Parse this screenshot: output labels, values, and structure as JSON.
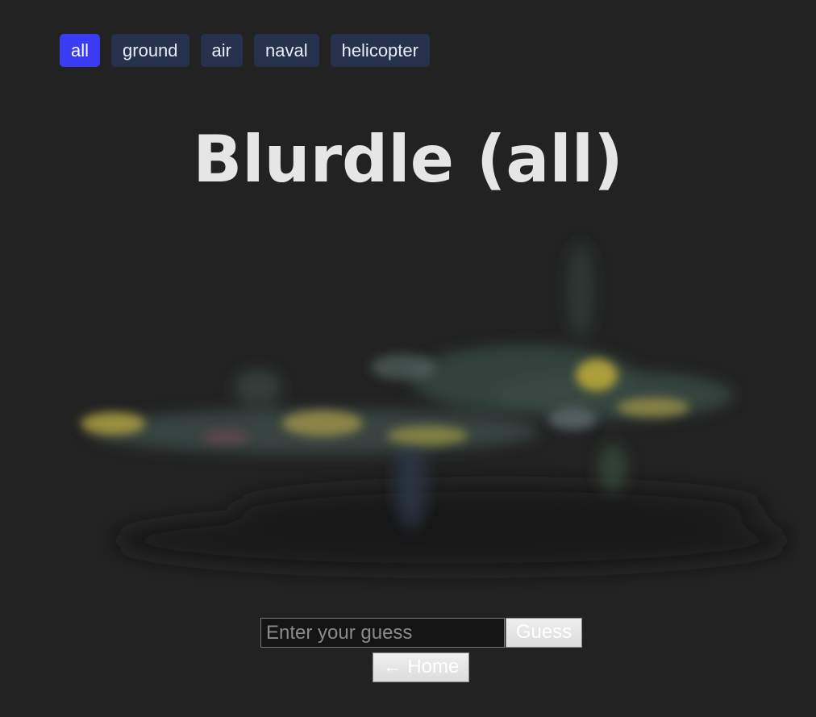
{
  "filters": {
    "items": [
      {
        "label": "all",
        "active": true
      },
      {
        "label": "ground",
        "active": false
      },
      {
        "label": "air",
        "active": false
      },
      {
        "label": "naval",
        "active": false
      },
      {
        "label": "helicopter",
        "active": false
      }
    ]
  },
  "header": {
    "title": "Blurdle (all)"
  },
  "puzzle": {
    "image_icon": "blurred-aircraft-image"
  },
  "guess": {
    "placeholder": "Enter your guess",
    "value": "",
    "button_label": "Guess"
  },
  "nav": {
    "home_label": "← Home"
  },
  "colors": {
    "background": "#222222",
    "filter_active": "#3a3cf5",
    "filter_inactive": "#26314e"
  }
}
